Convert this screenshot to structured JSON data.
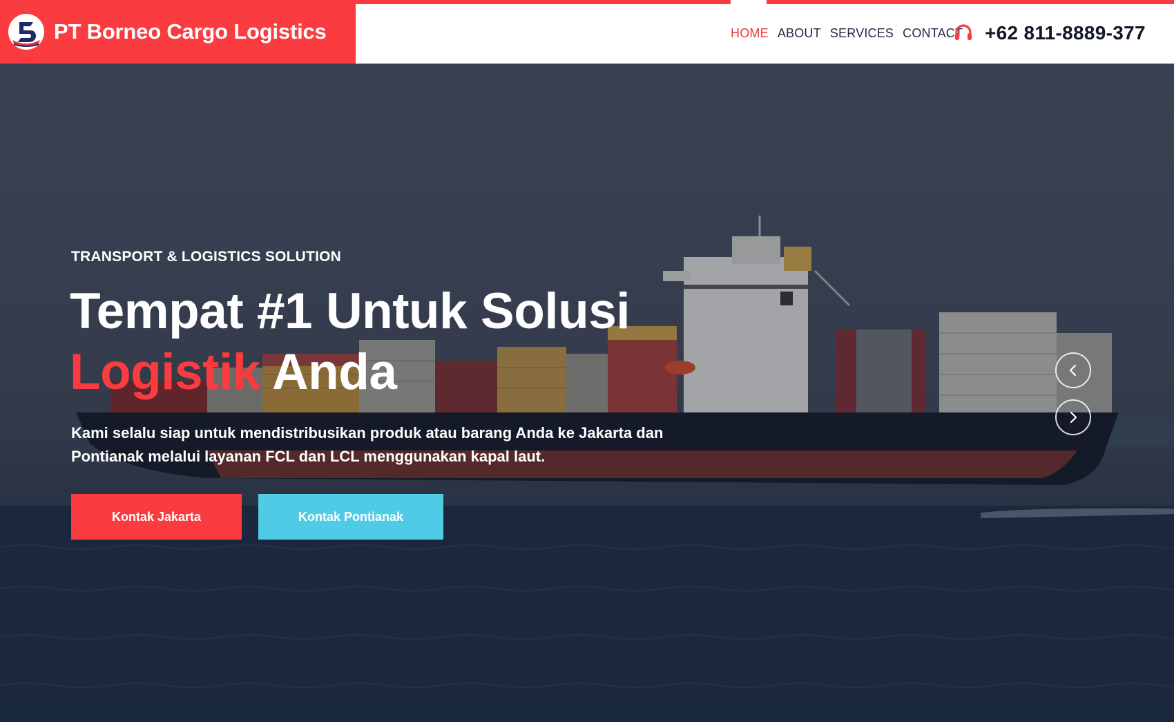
{
  "brand": {
    "name": "PT Borneo Cargo Logistics",
    "logo_icon": "ship-logo-icon",
    "color": "#fa3c40"
  },
  "nav": {
    "items": [
      {
        "label": "HOME",
        "active": true
      },
      {
        "label": "ABOUT",
        "active": false
      },
      {
        "label": "SERVICES",
        "active": false
      },
      {
        "label": "CONTACT",
        "active": false
      }
    ],
    "active_color": "#e8343a",
    "text_color": "#1f2a44"
  },
  "contact": {
    "icon": "headset-icon",
    "phone": "+62 811-8889-377"
  },
  "hero": {
    "kicker": "TRANSPORT & LOGISTICS SOLUTION",
    "title_line1": "Tempat #1 Untuk Solusi",
    "title_accent": "Logistik",
    "title_rest": "Anda",
    "description": "Kami selalu siap untuk mendistribusikan produk atau barang Anda ke Jakarta dan Pontianak melalui layanan FCL dan LCL menggunakan kapal laut.",
    "buttons": {
      "primary": "Kontak Jakarta",
      "secondary": "Kontak Pontianak"
    },
    "background": "container-ship-at-sea",
    "slider": {
      "prev_icon": "chevron-left-icon",
      "next_icon": "chevron-right-icon"
    }
  },
  "colors": {
    "accent_red": "#fa3c40",
    "accent_cyan": "#4fcbe6"
  }
}
